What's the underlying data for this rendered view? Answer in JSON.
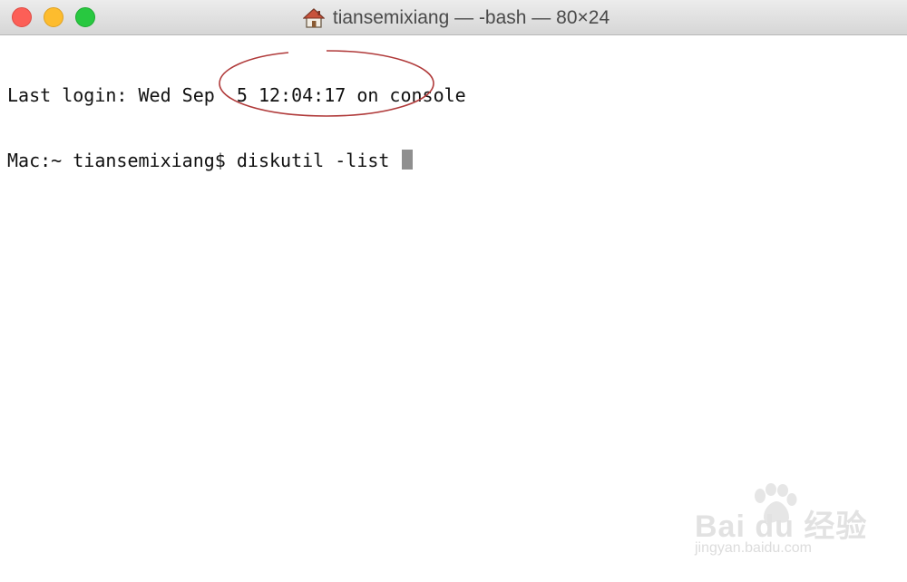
{
  "window": {
    "title": "tiansemixiang — -bash — 80×24",
    "title_icon": "home-icon",
    "traffic_lights": {
      "close_color": "#fc5f57",
      "minimize_color": "#fdbc2e",
      "zoom_color": "#28c840"
    }
  },
  "terminal": {
    "lines": [
      "Last login: Wed Sep  5 12:04:17 on console",
      "Mac:~ tiansemixiang$ diskutil -list "
    ],
    "cursor": "block-cursor",
    "annotation_color": "#b03a3a"
  },
  "watermark": {
    "logo": "Bai du 经验",
    "url": "jingyan.baidu.com"
  }
}
